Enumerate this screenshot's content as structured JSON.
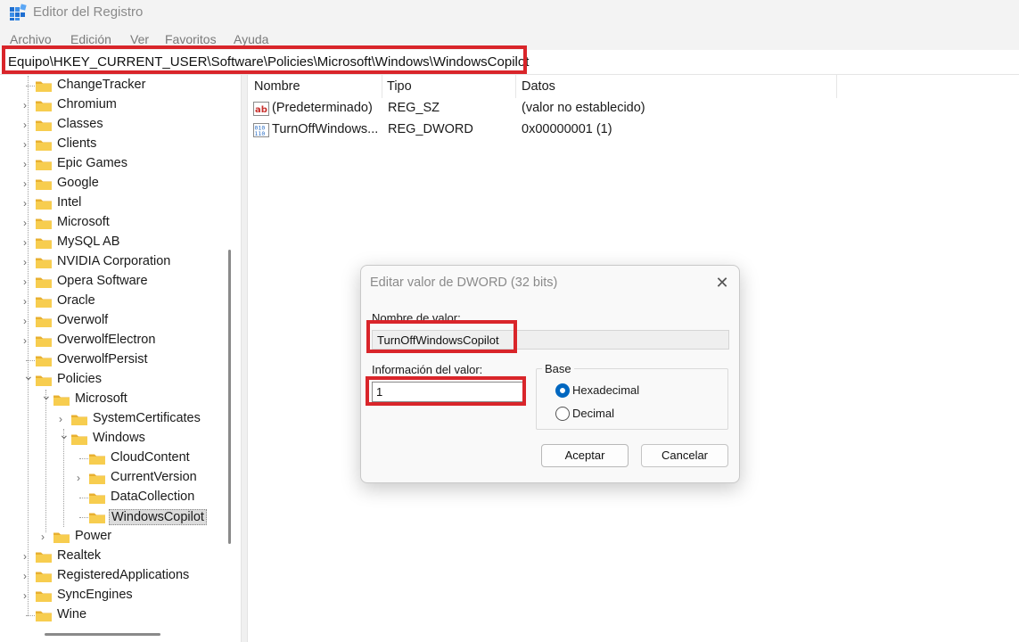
{
  "window": {
    "title": "Editor del Registro"
  },
  "menu": [
    "Archivo",
    "Edición",
    "Ver",
    "Favoritos",
    "Ayuda"
  ],
  "address": "Equipo\\HKEY_CURRENT_USER\\Software\\Policies\\Microsoft\\Windows\\WindowsCopilot",
  "tree": {
    "items": [
      {
        "label": "ChangeTracker",
        "level": 0,
        "expander": "none"
      },
      {
        "label": "Chromium",
        "level": 0,
        "expander": "collapsed"
      },
      {
        "label": "Classes",
        "level": 0,
        "expander": "collapsed"
      },
      {
        "label": "Clients",
        "level": 0,
        "expander": "collapsed"
      },
      {
        "label": "Epic Games",
        "level": 0,
        "expander": "collapsed"
      },
      {
        "label": "Google",
        "level": 0,
        "expander": "collapsed"
      },
      {
        "label": "Intel",
        "level": 0,
        "expander": "collapsed"
      },
      {
        "label": "Microsoft",
        "level": 0,
        "expander": "collapsed"
      },
      {
        "label": "MySQL AB",
        "level": 0,
        "expander": "collapsed"
      },
      {
        "label": "NVIDIA Corporation",
        "level": 0,
        "expander": "collapsed"
      },
      {
        "label": "Opera Software",
        "level": 0,
        "expander": "collapsed"
      },
      {
        "label": "Oracle",
        "level": 0,
        "expander": "collapsed"
      },
      {
        "label": "Overwolf",
        "level": 0,
        "expander": "collapsed"
      },
      {
        "label": "OverwolfElectron",
        "level": 0,
        "expander": "collapsed"
      },
      {
        "label": "OverwolfPersist",
        "level": 0,
        "expander": "none"
      },
      {
        "label": "Policies",
        "level": 0,
        "expander": "expanded"
      },
      {
        "label": "Microsoft",
        "level": 1,
        "expander": "expanded"
      },
      {
        "label": "SystemCertificates",
        "level": 2,
        "expander": "collapsed"
      },
      {
        "label": "Windows",
        "level": 2,
        "expander": "expanded"
      },
      {
        "label": "CloudContent",
        "level": 3,
        "expander": "none"
      },
      {
        "label": "CurrentVersion",
        "level": 3,
        "expander": "collapsed"
      },
      {
        "label": "DataCollection",
        "level": 3,
        "expander": "none"
      },
      {
        "label": "WindowsCopilot",
        "level": 3,
        "expander": "none",
        "selected": true
      },
      {
        "label": "Power",
        "level": 1,
        "expander": "collapsed"
      },
      {
        "label": "Realtek",
        "level": 0,
        "expander": "collapsed"
      },
      {
        "label": "RegisteredApplications",
        "level": 0,
        "expander": "collapsed"
      },
      {
        "label": "SyncEngines",
        "level": 0,
        "expander": "collapsed"
      },
      {
        "label": "Wine",
        "level": 0,
        "expander": "none"
      }
    ]
  },
  "list": {
    "columns": [
      "Nombre",
      "Tipo",
      "Datos"
    ],
    "rows": [
      {
        "icon": "string-value-icon",
        "name": "(Predeterminado)",
        "type": "REG_SZ",
        "data": "(valor no establecido)"
      },
      {
        "icon": "binary-value-icon",
        "name": "TurnOffWindows...",
        "type": "REG_DWORD",
        "data": "0x00000001 (1)"
      }
    ]
  },
  "dialog": {
    "title": "Editar valor de DWORD (32 bits)",
    "name_label": "Nombre de valor:",
    "name_value": "TurnOffWindowsCopilot",
    "value_label": "Información del valor:",
    "value": "1",
    "base_label": "Base",
    "hex_label": "Hexadecimal",
    "dec_label": "Decimal",
    "selected_base": "Hexadecimal",
    "ok_label": "Aceptar",
    "cancel_label": "Cancelar"
  },
  "colors": {
    "highlight_red": "#d9252a",
    "folder_yellow": "#f5c542",
    "accent_blue": "#0067c0"
  }
}
